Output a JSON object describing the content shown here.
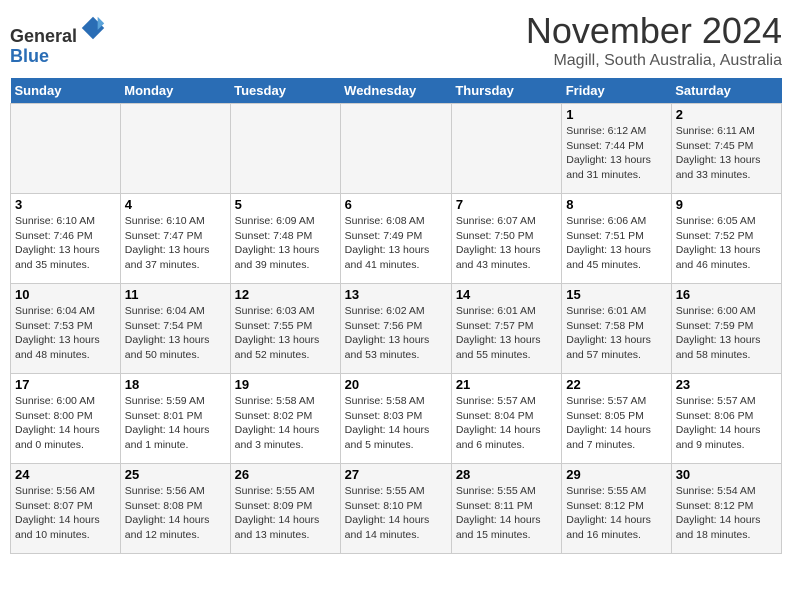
{
  "header": {
    "logo_line1": "General",
    "logo_line2": "Blue",
    "month": "November 2024",
    "location": "Magill, South Australia, Australia"
  },
  "days_of_week": [
    "Sunday",
    "Monday",
    "Tuesday",
    "Wednesday",
    "Thursday",
    "Friday",
    "Saturday"
  ],
  "weeks": [
    [
      {
        "day": "",
        "info": ""
      },
      {
        "day": "",
        "info": ""
      },
      {
        "day": "",
        "info": ""
      },
      {
        "day": "",
        "info": ""
      },
      {
        "day": "",
        "info": ""
      },
      {
        "day": "1",
        "info": "Sunrise: 6:12 AM\nSunset: 7:44 PM\nDaylight: 13 hours\nand 31 minutes."
      },
      {
        "day": "2",
        "info": "Sunrise: 6:11 AM\nSunset: 7:45 PM\nDaylight: 13 hours\nand 33 minutes."
      }
    ],
    [
      {
        "day": "3",
        "info": "Sunrise: 6:10 AM\nSunset: 7:46 PM\nDaylight: 13 hours\nand 35 minutes."
      },
      {
        "day": "4",
        "info": "Sunrise: 6:10 AM\nSunset: 7:47 PM\nDaylight: 13 hours\nand 37 minutes."
      },
      {
        "day": "5",
        "info": "Sunrise: 6:09 AM\nSunset: 7:48 PM\nDaylight: 13 hours\nand 39 minutes."
      },
      {
        "day": "6",
        "info": "Sunrise: 6:08 AM\nSunset: 7:49 PM\nDaylight: 13 hours\nand 41 minutes."
      },
      {
        "day": "7",
        "info": "Sunrise: 6:07 AM\nSunset: 7:50 PM\nDaylight: 13 hours\nand 43 minutes."
      },
      {
        "day": "8",
        "info": "Sunrise: 6:06 AM\nSunset: 7:51 PM\nDaylight: 13 hours\nand 45 minutes."
      },
      {
        "day": "9",
        "info": "Sunrise: 6:05 AM\nSunset: 7:52 PM\nDaylight: 13 hours\nand 46 minutes."
      }
    ],
    [
      {
        "day": "10",
        "info": "Sunrise: 6:04 AM\nSunset: 7:53 PM\nDaylight: 13 hours\nand 48 minutes."
      },
      {
        "day": "11",
        "info": "Sunrise: 6:04 AM\nSunset: 7:54 PM\nDaylight: 13 hours\nand 50 minutes."
      },
      {
        "day": "12",
        "info": "Sunrise: 6:03 AM\nSunset: 7:55 PM\nDaylight: 13 hours\nand 52 minutes."
      },
      {
        "day": "13",
        "info": "Sunrise: 6:02 AM\nSunset: 7:56 PM\nDaylight: 13 hours\nand 53 minutes."
      },
      {
        "day": "14",
        "info": "Sunrise: 6:01 AM\nSunset: 7:57 PM\nDaylight: 13 hours\nand 55 minutes."
      },
      {
        "day": "15",
        "info": "Sunrise: 6:01 AM\nSunset: 7:58 PM\nDaylight: 13 hours\nand 57 minutes."
      },
      {
        "day": "16",
        "info": "Sunrise: 6:00 AM\nSunset: 7:59 PM\nDaylight: 13 hours\nand 58 minutes."
      }
    ],
    [
      {
        "day": "17",
        "info": "Sunrise: 6:00 AM\nSunset: 8:00 PM\nDaylight: 14 hours\nand 0 minutes."
      },
      {
        "day": "18",
        "info": "Sunrise: 5:59 AM\nSunset: 8:01 PM\nDaylight: 14 hours\nand 1 minute."
      },
      {
        "day": "19",
        "info": "Sunrise: 5:58 AM\nSunset: 8:02 PM\nDaylight: 14 hours\nand 3 minutes."
      },
      {
        "day": "20",
        "info": "Sunrise: 5:58 AM\nSunset: 8:03 PM\nDaylight: 14 hours\nand 5 minutes."
      },
      {
        "day": "21",
        "info": "Sunrise: 5:57 AM\nSunset: 8:04 PM\nDaylight: 14 hours\nand 6 minutes."
      },
      {
        "day": "22",
        "info": "Sunrise: 5:57 AM\nSunset: 8:05 PM\nDaylight: 14 hours\nand 7 minutes."
      },
      {
        "day": "23",
        "info": "Sunrise: 5:57 AM\nSunset: 8:06 PM\nDaylight: 14 hours\nand 9 minutes."
      }
    ],
    [
      {
        "day": "24",
        "info": "Sunrise: 5:56 AM\nSunset: 8:07 PM\nDaylight: 14 hours\nand 10 minutes."
      },
      {
        "day": "25",
        "info": "Sunrise: 5:56 AM\nSunset: 8:08 PM\nDaylight: 14 hours\nand 12 minutes."
      },
      {
        "day": "26",
        "info": "Sunrise: 5:55 AM\nSunset: 8:09 PM\nDaylight: 14 hours\nand 13 minutes."
      },
      {
        "day": "27",
        "info": "Sunrise: 5:55 AM\nSunset: 8:10 PM\nDaylight: 14 hours\nand 14 minutes."
      },
      {
        "day": "28",
        "info": "Sunrise: 5:55 AM\nSunset: 8:11 PM\nDaylight: 14 hours\nand 15 minutes."
      },
      {
        "day": "29",
        "info": "Sunrise: 5:55 AM\nSunset: 8:12 PM\nDaylight: 14 hours\nand 16 minutes."
      },
      {
        "day": "30",
        "info": "Sunrise: 5:54 AM\nSunset: 8:12 PM\nDaylight: 14 hours\nand 18 minutes."
      }
    ]
  ]
}
